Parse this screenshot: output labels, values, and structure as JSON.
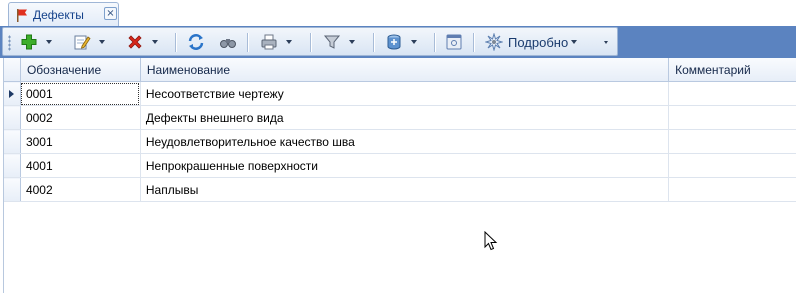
{
  "tab": {
    "label": "Дефекты",
    "close_glyph": "×"
  },
  "toolbar": {
    "buttons": [
      {
        "name": "add-button",
        "icon": "plus-icon"
      },
      {
        "name": "edit-button",
        "icon": "edit-icon"
      },
      {
        "name": "delete-button",
        "icon": "delete-icon"
      },
      {
        "name": "refresh-button",
        "icon": "refresh-icon"
      },
      {
        "name": "find-button",
        "icon": "binoculars-icon"
      },
      {
        "name": "print-button",
        "icon": "printer-icon"
      },
      {
        "name": "filter-button",
        "icon": "filter-icon"
      },
      {
        "name": "export-button",
        "icon": "database-icon"
      },
      {
        "name": "settings-button",
        "icon": "window-icon"
      }
    ],
    "detail_label": "Подробно"
  },
  "grid": {
    "columns": [
      "Обозначение",
      "Наименование",
      "Комментарий"
    ],
    "rows": [
      {
        "code": "0001",
        "name": "Несоответствие чертежу",
        "comment": ""
      },
      {
        "code": "0002",
        "name": "Дефекты внешнего вида",
        "comment": ""
      },
      {
        "code": "3001",
        "name": "Неудовлетворительное качество шва",
        "comment": ""
      },
      {
        "code": "4001",
        "name": "Непрокрашенные поверхности",
        "comment": ""
      },
      {
        "code": "4002",
        "name": "Наплывы",
        "comment": ""
      }
    ]
  },
  "colors": {
    "toolbar_band": "#5b83c0",
    "header_text": "#15284a"
  }
}
